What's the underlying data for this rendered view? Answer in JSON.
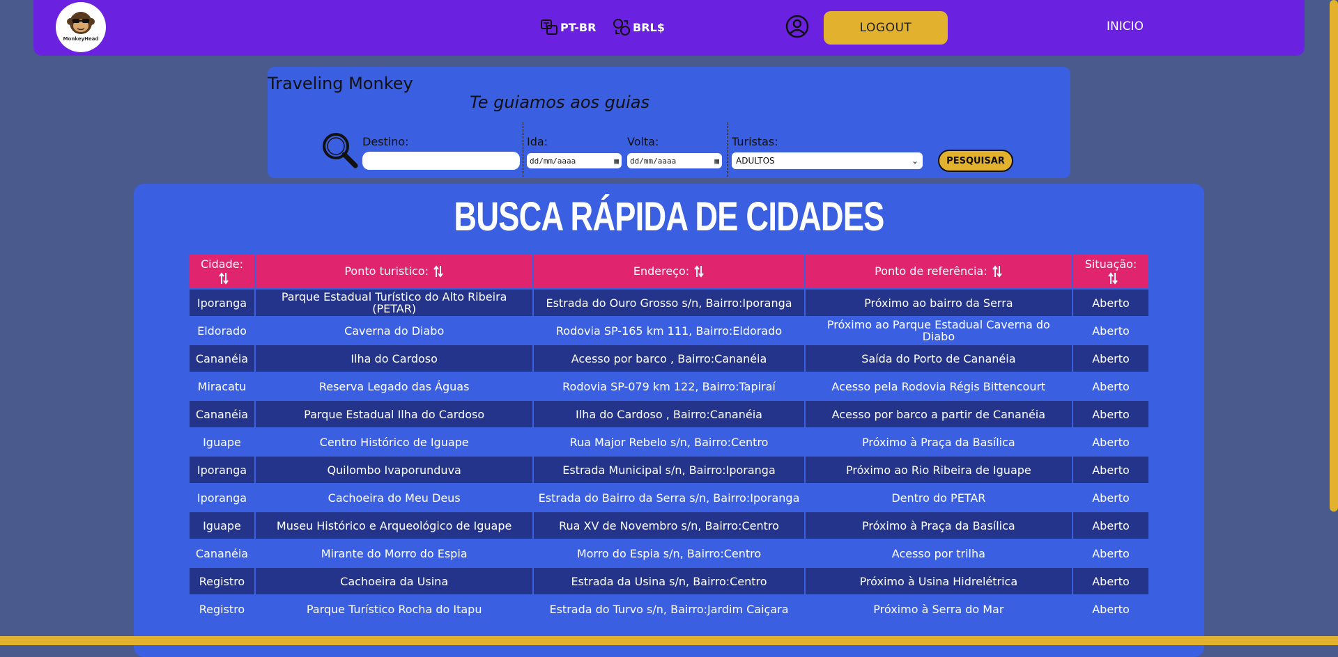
{
  "header": {
    "logo_alt": "MonkeyHead",
    "language": "PT-BR",
    "currency": "BRL$",
    "logout": "LOGOUT",
    "inicio": "INICIO"
  },
  "search": {
    "brand": "Traveling Monkey",
    "tagline": "Te guiamos aos guias",
    "destino_label": "Destino:",
    "ida_label": "Ida:",
    "volta_label": "Volta:",
    "turistas_label": "Turistas:",
    "date_placeholder": "dd/mm/aaaa",
    "turistas_value": "ADULTOS",
    "search_button": "PESQUISAR"
  },
  "table": {
    "title": "BUSCA RÁPIDA DE CIDADES",
    "headers": [
      "Cidade:",
      "Ponto turistico:",
      "Endereço:",
      "Ponto de referência:",
      "Situação:"
    ],
    "rows": [
      [
        "Iporanga",
        "Parque Estadual Turístico do Alto Ribeira (PETAR)",
        "Estrada do Ouro Grosso s/n, Bairro:Iporanga",
        "Próximo ao bairro da Serra",
        "Aberto"
      ],
      [
        "Eldorado",
        "Caverna do Diabo",
        "Rodovia SP-165 km 111, Bairro:Eldorado",
        "Próximo ao Parque Estadual Caverna do Diabo",
        "Aberto"
      ],
      [
        "Cananéia",
        "Ilha do Cardoso",
        "Acesso por barco , Bairro:Cananéia",
        "Saída do Porto de Cananéia",
        "Aberto"
      ],
      [
        "Miracatu",
        "Reserva Legado das Águas",
        "Rodovia SP-079 km 122, Bairro:Tapiraí",
        "Acesso pela Rodovia Régis Bittencourt",
        "Aberto"
      ],
      [
        "Cananéia",
        "Parque Estadual Ilha do Cardoso",
        "Ilha do Cardoso , Bairro:Cananéia",
        "Acesso por barco a partir de Cananéia",
        "Aberto"
      ],
      [
        "Iguape",
        "Centro Histórico de Iguape",
        "Rua Major Rebelo s/n, Bairro:Centro",
        "Próximo à Praça da Basílica",
        "Aberto"
      ],
      [
        "Iporanga",
        "Quilombo Ivaporunduva",
        "Estrada Municipal s/n, Bairro:Iporanga",
        "Próximo ao Rio Ribeira de Iguape",
        "Aberto"
      ],
      [
        "Iporanga",
        "Cachoeira do Meu Deus",
        "Estrada do Bairro da Serra s/n, Bairro:Iporanga",
        "Dentro do PETAR",
        "Aberto"
      ],
      [
        "Iguape",
        "Museu Histórico e Arqueológico de Iguape",
        "Rua XV de Novembro s/n, Bairro:Centro",
        "Próximo à Praça da Basílica",
        "Aberto"
      ],
      [
        "Cananéia",
        "Mirante do Morro do Espia",
        "Morro do Espia s/n, Bairro:Centro",
        "Acesso por trilha",
        "Aberto"
      ],
      [
        "Registro",
        "Cachoeira da Usina",
        "Estrada da Usina s/n, Bairro:Centro",
        "Próximo à Usina Hidrelétrica",
        "Aberto"
      ],
      [
        "Registro",
        "Parque Turístico Rocha do Itapu",
        "Estrada do Turvo s/n, Bairro:Jardim Caiçara",
        "Próximo à Serra do Mar",
        "Aberto"
      ]
    ]
  },
  "colors": {
    "topbar": "#6a22e0",
    "panel": "#3a5fe0",
    "accent": "#e2b22e",
    "header_row": "#e0246e",
    "row_dark": "#23348a",
    "background": "#4a5a8c"
  }
}
